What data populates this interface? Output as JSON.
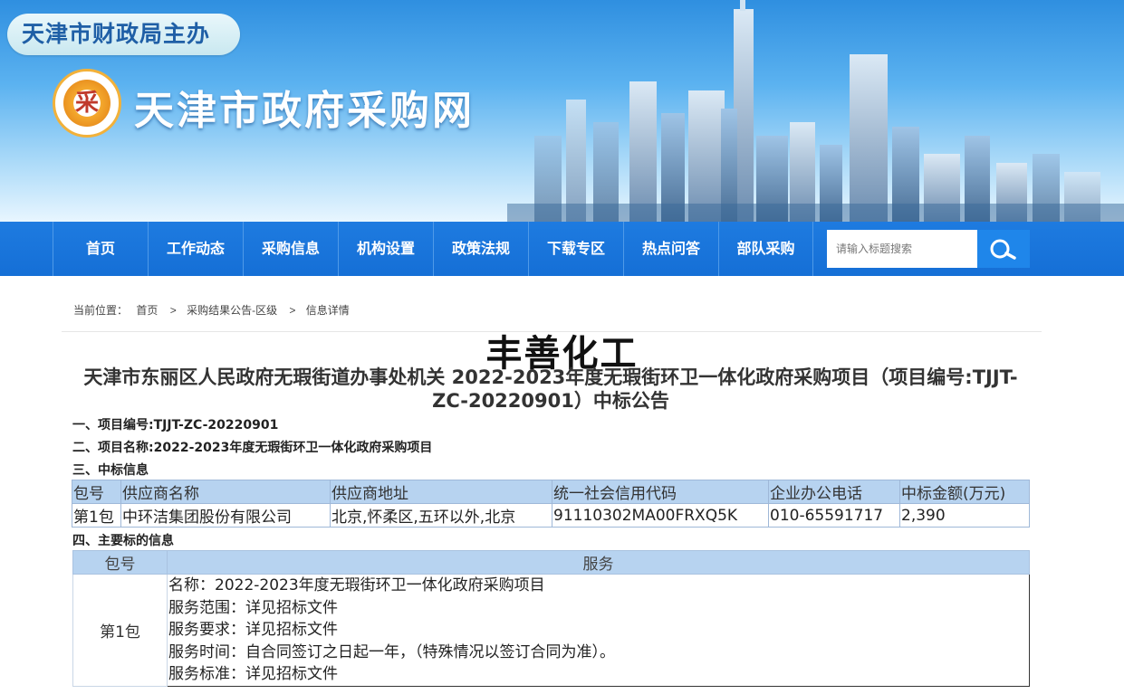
{
  "header": {
    "host": "天津市财政局主办",
    "logo_text": "采",
    "site_title": "天津市政府采购网"
  },
  "nav": {
    "items": [
      "首页",
      "工作动态",
      "采购信息",
      "机构设置",
      "政策法规",
      "下载专区",
      "热点问答",
      "部队采购"
    ],
    "search_placeholder": "请输入标题搜索",
    "search_icon": "search-icon"
  },
  "breadcrumb": {
    "label": "当前位置：",
    "items": [
      "首页",
      "采购结果公告-区级",
      "信息详情"
    ],
    "separator": ">"
  },
  "article": {
    "watermark": "丰善化工",
    "title": "天津市东丽区人民政府无瑕街道办事处机关 2022-2023年度无瑕街环卫一体化政府采购项目（项目编号:TJJT-ZC-20220901）中标公告",
    "section1": "一、项目编号:TJJT-ZC-20220901",
    "section2": "二、项目名称:2022-2023年度无瑕街环卫一体化政府采购项目",
    "section3": "三、中标信息",
    "section4": "四、主要标的信息"
  },
  "award_table": {
    "headers": [
      "包号",
      "供应商名称",
      "供应商地址",
      "统一社会信用代码",
      "企业办公电话",
      "中标金额(万元)"
    ],
    "rows": [
      [
        "第1包",
        "中环洁集团股份有限公司",
        "北京,怀柔区,五环以外,北京",
        "91110302MA00FRXQ5K",
        "010-65591717",
        "2,390"
      ]
    ]
  },
  "subject_table": {
    "headers": [
      "包号",
      "服务"
    ],
    "package": "第1包",
    "lines": [
      "名称：2022-2023年度无瑕街环卫一体化政府采购项目",
      "服务范围：详见招标文件",
      "服务要求：详见招标文件",
      "服务时间：自合同签订之日起一年，（特殊情况以签订合同为准）。",
      "服务标准：详见招标文件"
    ]
  },
  "colors": {
    "nav_bg": "#156fd6",
    "table_header_bg": "#b7d3f0",
    "banner_sky": "#5bb2f0"
  }
}
